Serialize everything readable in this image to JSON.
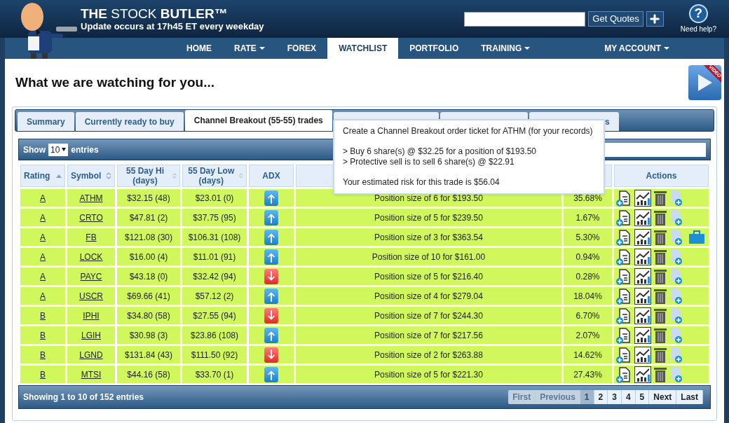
{
  "header": {
    "title": "**THE** STOCK **BUTLER™**",
    "subtitle": "Update occurs at 17h45 ET every weekday",
    "quote_button": "Get Quotes",
    "help_icon": "?",
    "help_label": "Need help?"
  },
  "nav": {
    "items": [
      {
        "label": "HOME",
        "dropdown": false,
        "selected": false
      },
      {
        "label": "RATE",
        "dropdown": true,
        "selected": false
      },
      {
        "label": "FOREX",
        "dropdown": false,
        "selected": false
      },
      {
        "label": "WATCHLIST",
        "dropdown": false,
        "selected": true
      },
      {
        "label": "PORTFOLIO",
        "dropdown": false,
        "selected": false
      },
      {
        "label": "TRAINING",
        "dropdown": true,
        "selected": false
      }
    ],
    "account": {
      "label": "MY ACCOUNT",
      "dropdown": true
    }
  },
  "page_title": "What we are watching for you...",
  "video_badge": "VIDEO",
  "tabs": [
    {
      "label": "Summary",
      "selected": false
    },
    {
      "label": "Currently ready to buy",
      "selected": false
    },
    {
      "label": "Channel Breakout (55-55) trades",
      "selected": true
    },
    {
      "selected": false
    },
    {
      "selected": false
    },
    {
      "label": "s",
      "selected": false
    }
  ],
  "table": {
    "show_label": "Show",
    "length": "10",
    "entries_label": "entries",
    "columns": [
      {
        "label": "Rating",
        "sortable": true,
        "sorted": true
      },
      {
        "label": "Symbol",
        "sortable": true,
        "sorted": false
      },
      {
        "label": "55 Day Hi (days)",
        "sortable": true,
        "sorted": false
      },
      {
        "label": "55 Day Low (days)",
        "sortable": true,
        "sorted": false
      },
      {
        "label": "ADX",
        "sortable": false
      },
      {
        "sortable": false
      },
      {
        "sortable": false
      },
      {
        "label": "Actions",
        "sortable": false
      }
    ],
    "rows": [
      {
        "rating": "A",
        "symbol": "ATHM",
        "hi": "$32.15 (48)",
        "low": "$23.01 (0)",
        "adx_up": true,
        "position": "Position size of 6 for $193.50",
        "pct": "35.68%",
        "briefcase": false
      },
      {
        "rating": "A",
        "symbol": "CRTO",
        "hi": "$47.81 (2)",
        "low": "$37.75 (95)",
        "adx_up": true,
        "position": "Position size of 5 for $239.50",
        "pct": "1.67%",
        "briefcase": false
      },
      {
        "rating": "A",
        "symbol": "FB",
        "hi": "$121.08 (30)",
        "low": "$106.31 (108)",
        "adx_up": true,
        "position": "Position size of 3 for $363.54",
        "pct": "5.30%",
        "briefcase": true
      },
      {
        "rating": "A",
        "symbol": "LOCK",
        "hi": "$16.00 (4)",
        "low": "$11.01 (91)",
        "adx_up": true,
        "position": "Position size of 10 for $161.00",
        "pct": "0.94%",
        "briefcase": false
      },
      {
        "rating": "A",
        "symbol": "PAYC",
        "hi": "$43.18 (0)",
        "low": "$32.42 (94)",
        "adx_up": false,
        "position": "Position size of 5 for $216.40",
        "pct": "0.28%",
        "briefcase": false
      },
      {
        "rating": "A",
        "symbol": "USCR",
        "hi": "$69.66 (41)",
        "low": "$57.12 (2)",
        "adx_up": true,
        "position": "Position size of 4 for $279.04",
        "pct": "18.04%",
        "briefcase": false
      },
      {
        "rating": "B",
        "symbol": "IPHI",
        "hi": "$34.80 (58)",
        "low": "$27.55 (94)",
        "adx_up": false,
        "position": "Position size of 7 for $244.30",
        "pct": "6.70%",
        "briefcase": false
      },
      {
        "rating": "B",
        "symbol": "LGIH",
        "hi": "$30.98 (3)",
        "low": "$23.86 (108)",
        "adx_up": true,
        "position": "Position size of 7 for $217.56",
        "pct": "2.07%",
        "briefcase": false
      },
      {
        "rating": "B",
        "symbol": "LGND",
        "hi": "$131.84 (43)",
        "low": "$111.50 (92)",
        "adx_up": false,
        "position": "Position size of 2 for $263.88",
        "pct": "14.62%",
        "briefcase": false
      },
      {
        "rating": "B",
        "symbol": "MTSI",
        "hi": "$44.16 (58)",
        "low": "$33.70 (1)",
        "adx_up": true,
        "position": "Position size of 5 for $221.30",
        "pct": "27.43%",
        "briefcase": false
      }
    ],
    "info": "Showing 1 to 10 of 152 entries",
    "pagination": [
      {
        "label": "First",
        "disabled": true,
        "selected": false
      },
      {
        "label": "Previous",
        "disabled": true,
        "selected": false
      },
      {
        "label": "1",
        "disabled": false,
        "selected": true
      },
      {
        "label": "2",
        "disabled": false,
        "selected": false
      },
      {
        "label": "3",
        "disabled": false,
        "selected": false
      },
      {
        "label": "4",
        "disabled": false,
        "selected": false
      },
      {
        "label": "5",
        "disabled": false,
        "selected": false
      },
      {
        "label": "Next",
        "disabled": false,
        "selected": false
      },
      {
        "label": "Last",
        "disabled": false,
        "selected": false
      }
    ]
  },
  "tooltip": {
    "paragraphs": [
      [
        "Create a Channel Breakout order ticket for ATHM (for your records)"
      ],
      [
        "> Buy 6 share(s) @ $32.25 for a position of $193.50",
        "> Protective sell is to sell 6 share(s) @ $22.91"
      ],
      [
        "Your estimated risk for this trade is $56.04"
      ]
    ]
  }
}
